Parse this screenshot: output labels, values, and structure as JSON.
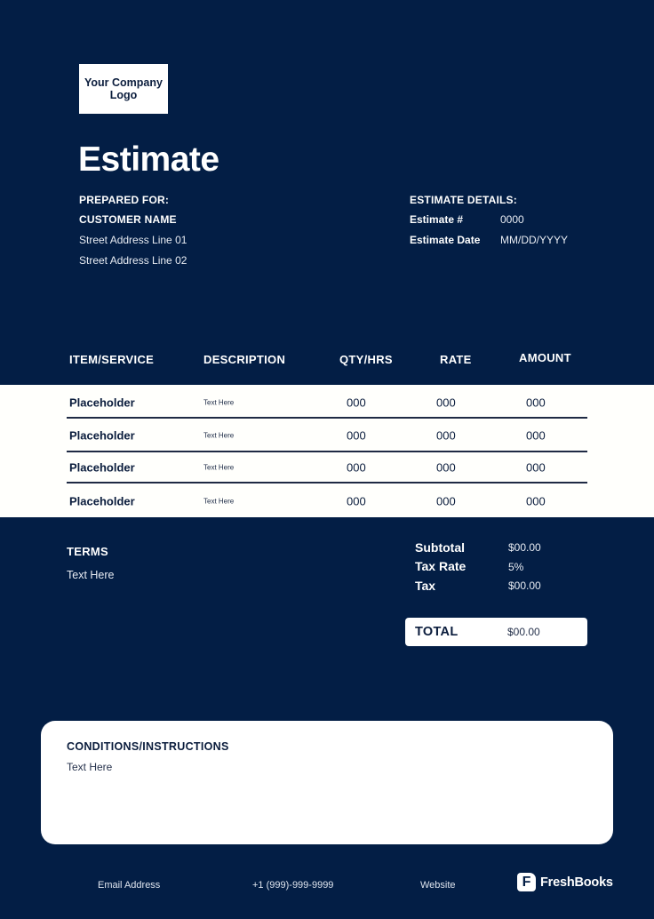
{
  "header": {
    "logo_text": "Your Company Logo",
    "title": "Estimate"
  },
  "prepared_for": {
    "heading": "PREPARED FOR:",
    "customer_name": "CUSTOMER NAME",
    "address_line_1": "Street Address Line 01",
    "address_line_2": "Street Address Line 02"
  },
  "estimate_details": {
    "heading": "ESTIMATE DETAILS:",
    "number_label": "Estimate #",
    "number_value": "0000",
    "date_label": "Estimate Date",
    "date_value": "MM/DD/YYYY"
  },
  "table": {
    "columns": [
      "ITEM/SERVICE",
      "DESCRIPTION",
      "QTY/HRS",
      "RATE",
      "AMOUNT"
    ],
    "rows": [
      {
        "item": "Placeholder",
        "description": "Text Here",
        "qty": "000",
        "rate": "000",
        "amount": "000"
      },
      {
        "item": "Placeholder",
        "description": "Text Here",
        "qty": "000",
        "rate": "000",
        "amount": "000"
      },
      {
        "item": "Placeholder",
        "description": "Text Here",
        "qty": "000",
        "rate": "000",
        "amount": "000"
      },
      {
        "item": "Placeholder",
        "description": "Text Here",
        "qty": "000",
        "rate": "000",
        "amount": "000"
      }
    ]
  },
  "terms": {
    "heading": "TERMS",
    "text": "Text Here"
  },
  "summary": {
    "subtotal_label": "Subtotal",
    "subtotal_value": "$00.00",
    "tax_rate_label": "Tax Rate",
    "tax_rate_value": "5%",
    "tax_label": "Tax",
    "tax_value": "$00.00",
    "total_label": "TOTAL",
    "total_value": "$00.00"
  },
  "conditions": {
    "heading": "CONDITIONS/INSTRUCTIONS",
    "text": "Text Here"
  },
  "footer": {
    "email": "Email Address",
    "phone": "+1 (999)-999-9999",
    "website": "Website",
    "brand_icon": "freshbooks-f-icon",
    "brand_icon_glyph": "F",
    "brand_name": "FreshBooks"
  },
  "colors": {
    "background": "#031e45",
    "panel": "#ffffff",
    "text_dark": "#0b1d3d"
  }
}
